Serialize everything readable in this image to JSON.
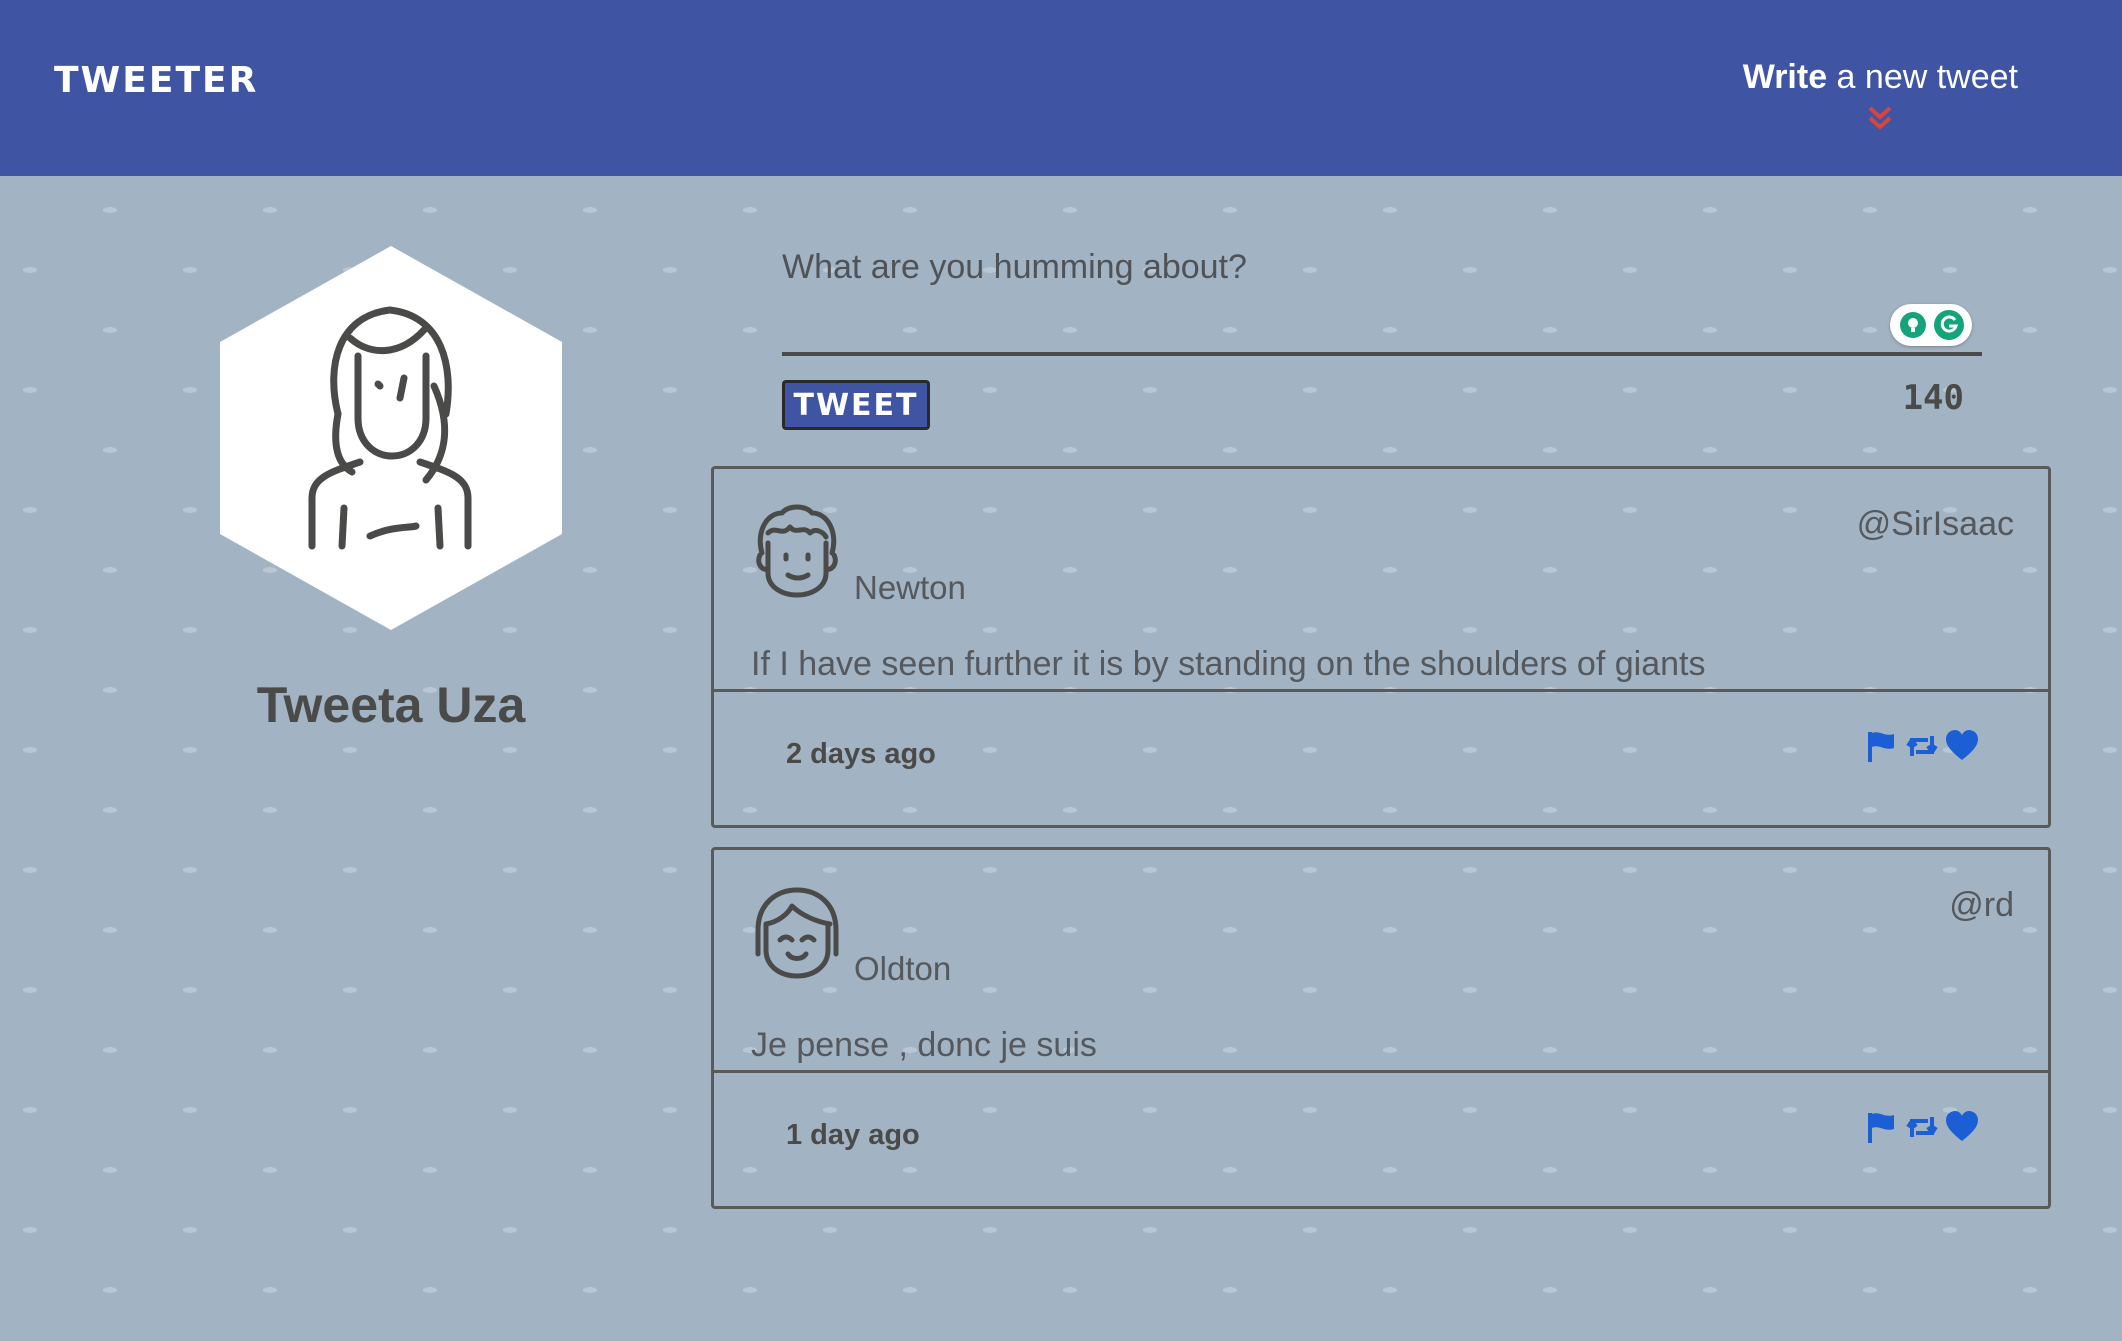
{
  "header": {
    "logo": "TWEETER",
    "compose_toggle": {
      "bold": "Write",
      "rest": " a new tweet"
    }
  },
  "profile": {
    "name": "Tweeta Uza"
  },
  "composer": {
    "placeholder": "What are you humming about?",
    "value": "",
    "button_label": "TWEET",
    "char_count": "140"
  },
  "tweets": [
    {
      "author": "Newton",
      "handle": "@SirIsaac",
      "text": "If I have seen further it is by standing on the shoulders of giants",
      "time": "2 days ago"
    },
    {
      "author": "Oldton",
      "handle": "@rd",
      "text": "Je pense , donc je suis",
      "time": "1 day ago"
    }
  ],
  "colors": {
    "header_bg": "#3f55a3",
    "page_bg": "#a2b3c3",
    "accent_red": "#d9453c",
    "action_blue": "#1c5fd4",
    "text_dark": "#4a4a48"
  }
}
